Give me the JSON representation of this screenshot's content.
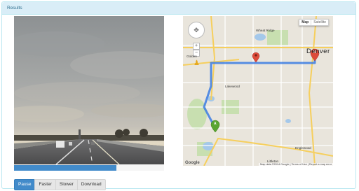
{
  "panel": {
    "title": "Results"
  },
  "street_view": {
    "progress_fraction": 0.68
  },
  "map": {
    "type_options": [
      "Map",
      "Satellite"
    ],
    "active_type": "Map",
    "pan_icon": "pan-arrows-icon",
    "zoom_in": "+",
    "zoom_out": "−",
    "city_major": "Denver",
    "city_labels": [
      "Lakewood",
      "Englewood",
      "Littleton",
      "Wheat Ridge",
      "Golden"
    ],
    "logo_text": "Google",
    "footer_text": "Map data ©2014 Google  |  Terms of Use  |  Report a map error",
    "marker_start": "A",
    "marker_end": "B",
    "colors": {
      "route": "#3b7de3",
      "start_marker": "#5aa532",
      "end_marker": "#dd4b39"
    }
  },
  "controls": {
    "pause": "Pause",
    "faster": "Faster",
    "slower": "Slower",
    "download": "Download"
  }
}
